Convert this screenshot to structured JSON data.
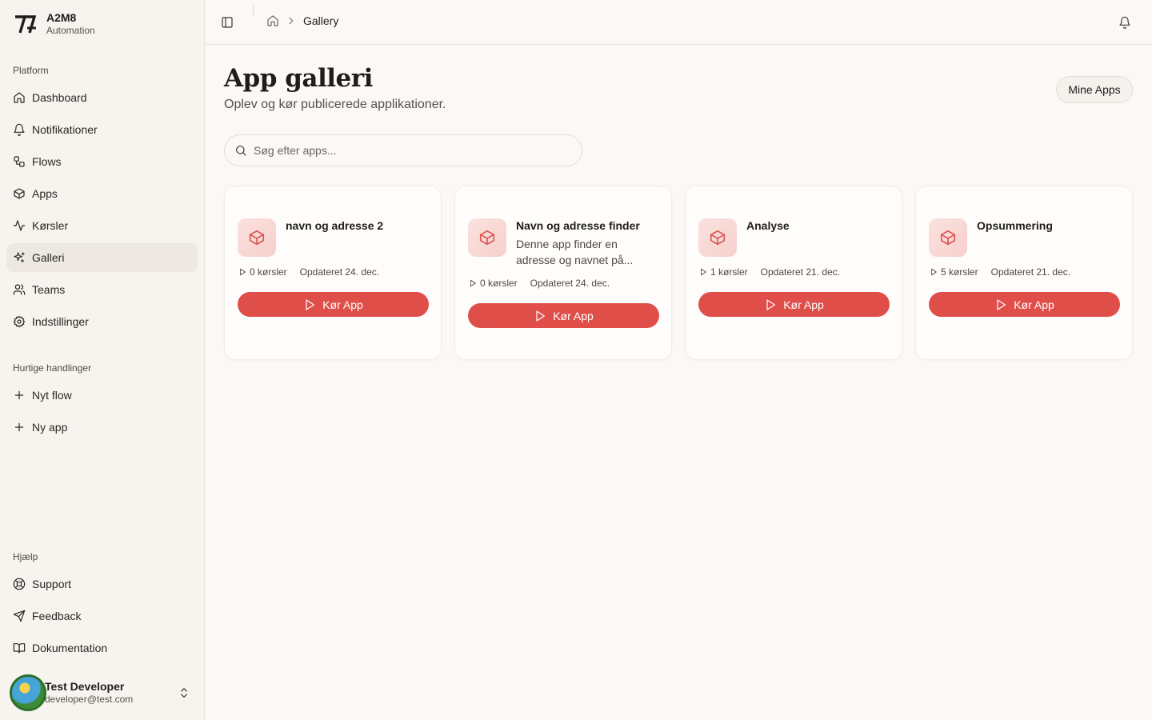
{
  "brand": {
    "name": "A2M8",
    "subtitle": "Automation"
  },
  "sidebar": {
    "platform_label": "Platform",
    "platform_items": [
      {
        "label": "Dashboard",
        "icon": "home-icon"
      },
      {
        "label": "Notifikationer",
        "icon": "bell-icon"
      },
      {
        "label": "Flows",
        "icon": "workflow-icon"
      },
      {
        "label": "Apps",
        "icon": "box-icon"
      },
      {
        "label": "Kørsler",
        "icon": "activity-icon"
      },
      {
        "label": "Galleri",
        "icon": "sparkles-icon",
        "active": true
      },
      {
        "label": "Teams",
        "icon": "users-icon"
      },
      {
        "label": "Indstillinger",
        "icon": "gear-icon"
      }
    ],
    "quick_label": "Hurtige handlinger",
    "quick_items": [
      {
        "label": "Nyt flow",
        "icon": "plus-icon"
      },
      {
        "label": "Ny app",
        "icon": "plus-icon"
      }
    ],
    "help_label": "Hjælp",
    "help_items": [
      {
        "label": "Support",
        "icon": "lifebuoy-icon"
      },
      {
        "label": "Feedback",
        "icon": "send-icon"
      },
      {
        "label": "Dokumentation",
        "icon": "book-icon"
      }
    ]
  },
  "user": {
    "name": "Test Developer",
    "email": "developer@test.com"
  },
  "topbar": {
    "breadcrumb_current": "Gallery"
  },
  "page": {
    "title": "App galleri",
    "subtitle": "Oplev og kør publicerede applikationer.",
    "mine_apps_label": "Mine Apps"
  },
  "search": {
    "placeholder": "Søg efter apps..."
  },
  "apps": [
    {
      "name": "navn og adresse 2",
      "description": "",
      "runs": "0 kørsler",
      "updated": "Opdateret 24. dec.",
      "button": "Kør App"
    },
    {
      "name": "Navn og adresse finder",
      "description": "Denne app finder en adresse og navnet på...",
      "runs": "0 kørsler",
      "updated": "Opdateret 24. dec.",
      "button": "Kør App"
    },
    {
      "name": "Analyse",
      "description": "",
      "runs": "1 kørsler",
      "updated": "Opdateret 21. dec.",
      "button": "Kør App"
    },
    {
      "name": "Opsummering",
      "description": "",
      "runs": "5 kørsler",
      "updated": "Opdateret 21. dec.",
      "button": "Kør App"
    }
  ],
  "colors": {
    "accent": "#e04e4a",
    "background": "#fbf9f5",
    "sidebar": "#f7f4ef"
  }
}
